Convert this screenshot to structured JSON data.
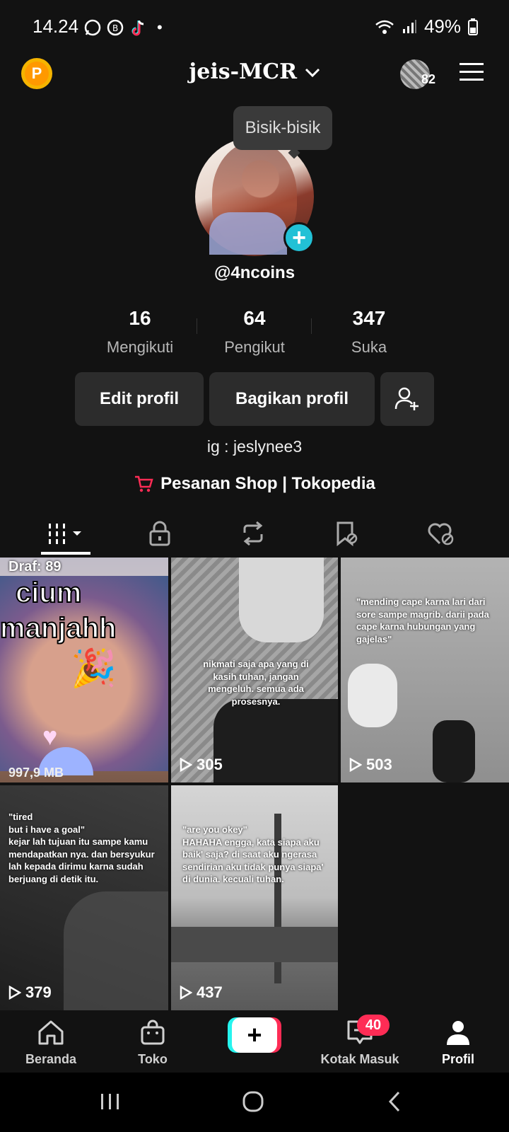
{
  "status_bar": {
    "time": "14.24",
    "battery": "49%",
    "notif_icons": [
      "whatsapp-icon",
      "whatsapp-business-icon",
      "tiktok-icon"
    ]
  },
  "header": {
    "username": "jeis-MCR",
    "coin_letter": "P",
    "friend_count": "82"
  },
  "profile": {
    "tooltip": "Bisik-bisik",
    "handle": "@4ncoins",
    "stats": [
      {
        "num": "16",
        "label": "Mengikuti"
      },
      {
        "num": "64",
        "label": "Pengikut"
      },
      {
        "num": "347",
        "label": "Suka"
      }
    ],
    "edit_button": "Edit profil",
    "share_button": "Bagikan profil",
    "bio": "ig : jeslynee3",
    "shop_link": "Pesanan Shop | Tokopedia"
  },
  "grid": {
    "draft_label": "Draf: 89",
    "draft_overlay_line1": "cium",
    "draft_overlay_line2": "manjahh",
    "draft_size": "997,9 MB",
    "videos": [
      {
        "views": "305",
        "caption": "nikmati saja apa yang di kasih tuhan, jangan mengeluh. semua ada prosesnya."
      },
      {
        "views": "503",
        "caption": "\"mending cape karna lari dari sore sampe magrib. darii pada cape karna hubungan yang gajelas\""
      },
      {
        "views": "379",
        "caption": "\"tired\nbut i have a goal\"\nkejar lah tujuan itu sampe kamu mendapatkan nya. dan bersyukur lah kepada dirimu karna sudah berjuang di detik itu."
      },
      {
        "views": "437",
        "caption": "\"are you okey\"\nHAHAHA engga, kata siapa aku baik' saja? di saat aku ngerasa sendirian aku tidak punya siapa' di dunia. kecuali tuhan."
      }
    ]
  },
  "nav": {
    "home": "Beranda",
    "shop": "Toko",
    "inbox": "Kotak Masuk",
    "inbox_badge": "40",
    "profile": "Profil"
  },
  "colors": {
    "background": "#121212",
    "accent_cyan": "#22c1d6",
    "accent_red": "#fe2c55",
    "coin": "#f5b400"
  }
}
